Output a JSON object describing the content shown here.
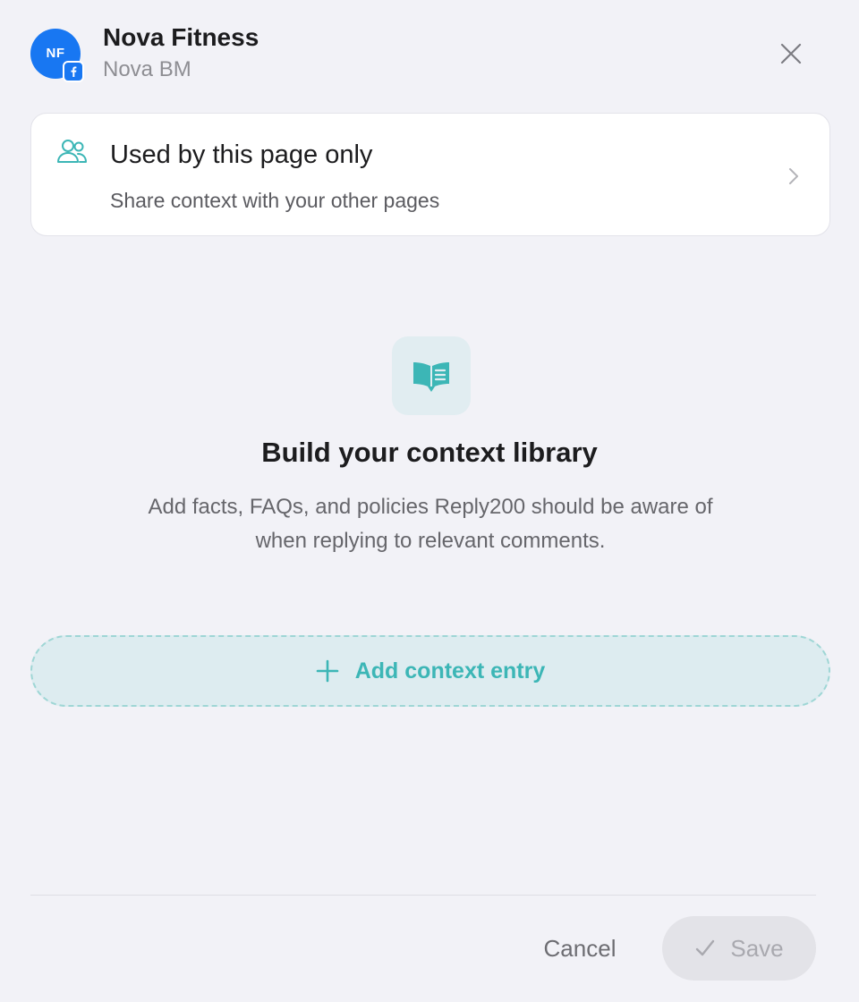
{
  "header": {
    "avatar_initials": "NF",
    "page_name": "Nova Fitness",
    "business_name": "Nova BM",
    "platform_icon": "facebook-icon",
    "close_icon": "close-icon"
  },
  "share_card": {
    "icon": "users-icon",
    "title": "Used by this page only",
    "description": "Share context with your other pages",
    "chevron_icon": "chevron-right-icon"
  },
  "empty_state": {
    "icon": "book-open-icon",
    "title": "Build your context library",
    "description": "Add facts, FAQs, and policies Reply200 should be aware of when replying to relevant comments."
  },
  "add_entry": {
    "icon": "plus-icon",
    "label": "Add context entry"
  },
  "footer": {
    "cancel_label": "Cancel",
    "save_label": "Save",
    "save_icon": "check-icon",
    "save_enabled": false
  },
  "colors": {
    "background": "#f2f2f7",
    "accent": "#3cb6b6",
    "facebook_blue": "#1877f2",
    "primary_text": "#1c1c1e",
    "secondary_text": "#8e8e93"
  }
}
